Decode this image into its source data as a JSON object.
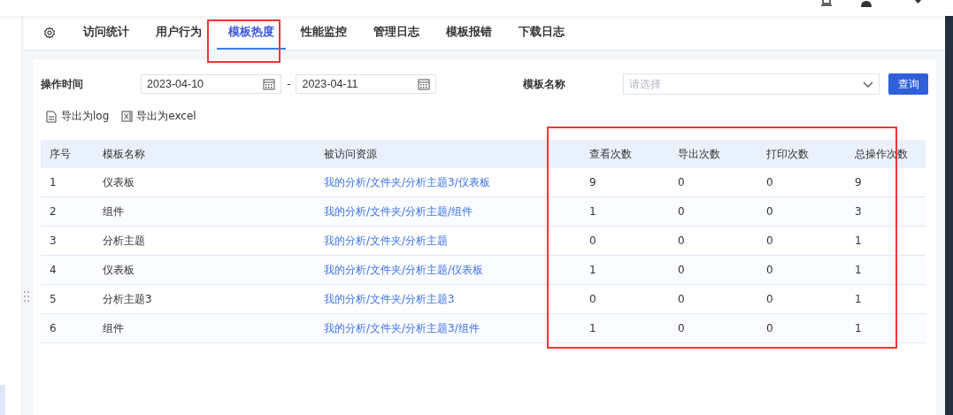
{
  "tabs": [
    {
      "label": "访问统计",
      "selected": false
    },
    {
      "label": "用户行为",
      "selected": false
    },
    {
      "label": "模板热度",
      "selected": true
    },
    {
      "label": "性能监控",
      "selected": false
    },
    {
      "label": "管理日志",
      "selected": false
    },
    {
      "label": "模板报错",
      "selected": false
    },
    {
      "label": "下载日志",
      "selected": false
    }
  ],
  "filters": {
    "time_label": "操作时间",
    "start_date": "2023-04-10",
    "separator": "-",
    "end_date": "2023-04-11",
    "name_label": "模板名称",
    "name_select": {
      "placeholder": "请选择"
    },
    "query_button": "查询"
  },
  "exports": [
    {
      "kind": "log",
      "label": "导出为log"
    },
    {
      "kind": "excel",
      "label": "导出为excel"
    }
  ],
  "table": {
    "columns": [
      "序号",
      "模板名称",
      "被访问资源",
      "查看次数",
      "导出次数",
      "打印次数",
      "总操作次数"
    ],
    "rows": [
      [
        "1",
        "仪表板",
        "我的分析/文件夹/分析主题3/仪表板",
        "9",
        "0",
        "0",
        "9"
      ],
      [
        "2",
        "组件",
        "我的分析/文件夹/分析主题/组件",
        "1",
        "0",
        "0",
        "3"
      ],
      [
        "3",
        "分析主题",
        "我的分析/文件夹/分析主题",
        "0",
        "0",
        "0",
        "1"
      ],
      [
        "4",
        "仪表板",
        "我的分析/文件夹/分析主题/仪表板",
        "1",
        "0",
        "0",
        "1"
      ],
      [
        "5",
        "分析主题3",
        "我的分析/文件夹/分析主题3",
        "0",
        "0",
        "0",
        "1"
      ],
      [
        "6",
        "组件",
        "我的分析/文件夹/分析主题3/组件",
        "1",
        "0",
        "0",
        "1"
      ]
    ]
  }
}
